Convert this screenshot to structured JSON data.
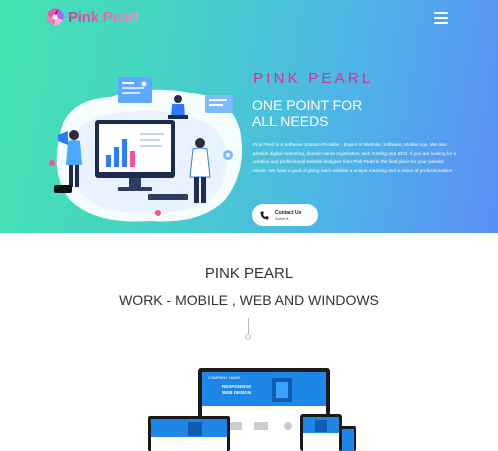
{
  "header": {
    "logo_text": "Pink Pearl",
    "menu_icon": "hamburger-icon"
  },
  "hero": {
    "brand_title": "PINK PEARL",
    "headline_line1": "ONE POINT FOR",
    "headline_line2": "ALL NEEDS",
    "description": "Pink Pearl is a Software Solution Provider - Expert in Website, Software, Mobile App. We also provide digital marketing, domain name registration, web hosting and SEO. If you are looking for a creative and professional website designer then Pink Pearl is the final place for your website needs. We have a goal of giving each website a unique meaning and a vision of professionalism",
    "contact_button": {
      "label": "Contact Us",
      "sublabel": "Solve it..",
      "icon": "phone-icon"
    }
  },
  "section": {
    "title": "PINK PEARL",
    "subtitle": "WORK - MOBILE , WEB AND WINDOWS"
  },
  "devices_screen": {
    "company_label": "COMPANY NAME",
    "hero_text_1": "RESPONSIVE",
    "hero_text_2": "WEB DESIGN"
  },
  "colors": {
    "gradient_start": "#43e3b2",
    "gradient_end": "#5a8ef6",
    "accent_pink": "#e02e8f"
  }
}
